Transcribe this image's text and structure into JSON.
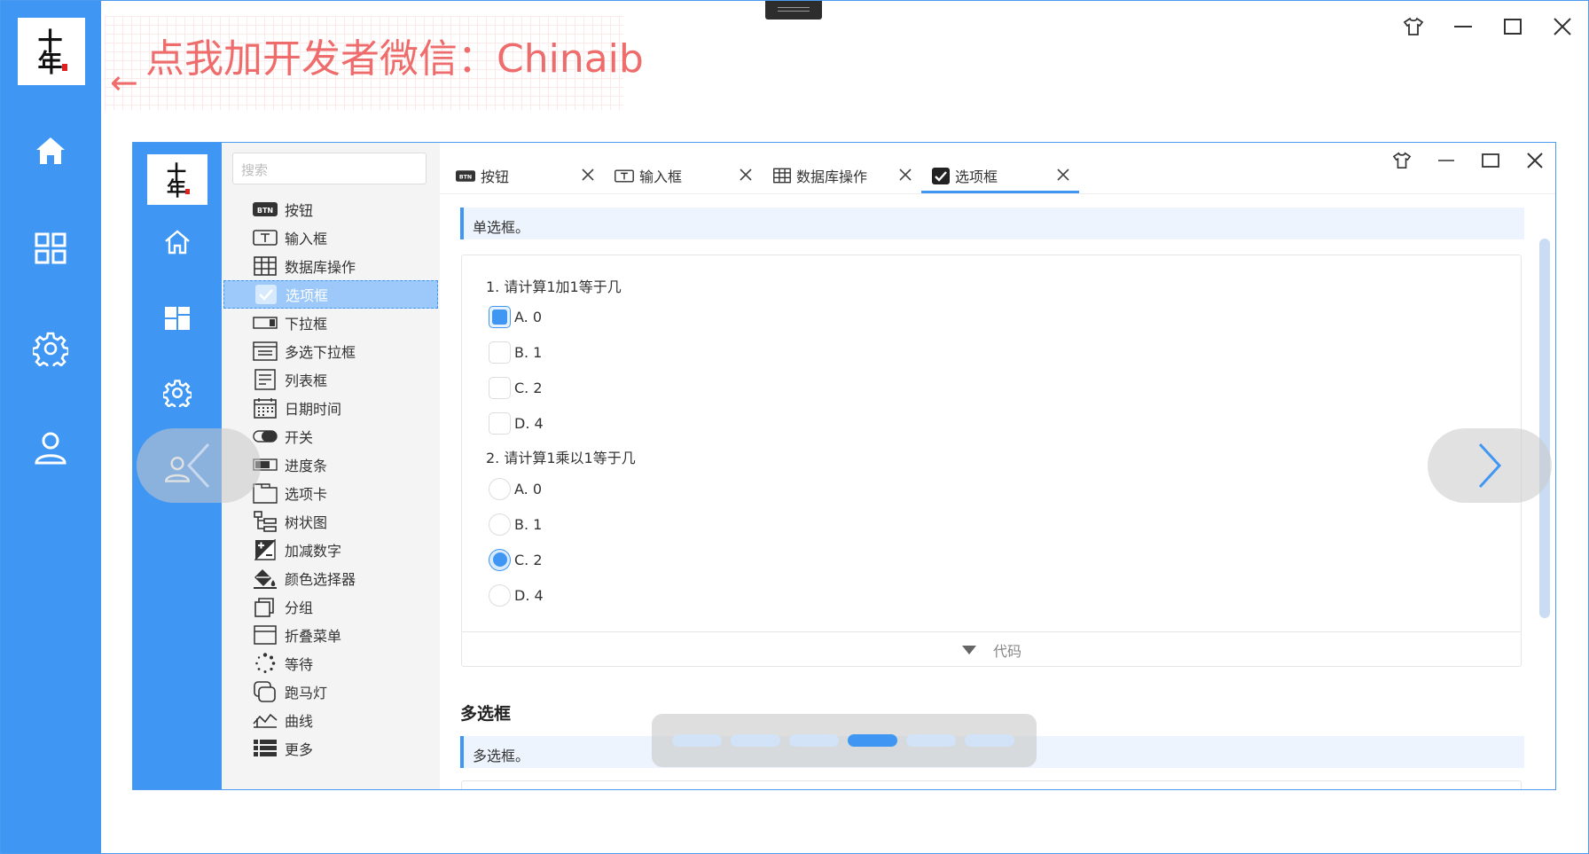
{
  "colors": {
    "accent": "#3f97f3",
    "promo": "#ef6c6c",
    "sidebar": "#3f97f3",
    "menu_active": "#9cc9fa"
  },
  "window": {
    "logo_text": "十年",
    "controls": [
      "shirt-icon",
      "minimize-icon",
      "maximize-icon",
      "close-icon"
    ]
  },
  "outer_nav": [
    {
      "icon": "home-icon"
    },
    {
      "icon": "grid-icon"
    },
    {
      "icon": "settings-icon"
    },
    {
      "icon": "user-icon"
    }
  ],
  "promo": {
    "text": "点我加开发者微信：Chinaib",
    "arrow": "←"
  },
  "inner": {
    "logo_text": "十年",
    "nav": [
      {
        "icon": "home-icon"
      },
      {
        "icon": "tiles-icon"
      },
      {
        "icon": "settings-icon"
      },
      {
        "icon": "user-icon"
      }
    ],
    "search_placeholder": "搜索",
    "menu": [
      {
        "label": "按钮",
        "icon": "btn-icon"
      },
      {
        "label": "输入框",
        "icon": "textbox-icon"
      },
      {
        "label": "数据库操作",
        "icon": "table-icon"
      },
      {
        "label": "选项框",
        "icon": "checkbox-icon",
        "active": true
      },
      {
        "label": "下拉框",
        "icon": "dropdown-icon"
      },
      {
        "label": "多选下拉框",
        "icon": "multiselect-icon"
      },
      {
        "label": "列表框",
        "icon": "listbox-icon"
      },
      {
        "label": "日期时间",
        "icon": "calendar-icon"
      },
      {
        "label": "开关",
        "icon": "toggle-icon"
      },
      {
        "label": "进度条",
        "icon": "progress-icon"
      },
      {
        "label": "选项卡",
        "icon": "tabs-icon"
      },
      {
        "label": "树状图",
        "icon": "tree-icon"
      },
      {
        "label": "加减数字",
        "icon": "plusminus-icon"
      },
      {
        "label": "颜色选择器",
        "icon": "paint-bucket-icon"
      },
      {
        "label": "分组",
        "icon": "group-icon"
      },
      {
        "label": "折叠菜单",
        "icon": "accordion-icon"
      },
      {
        "label": "等待",
        "icon": "spinner-icon"
      },
      {
        "label": "跑马灯",
        "icon": "marquee-icon"
      },
      {
        "label": "曲线",
        "icon": "curve-icon"
      },
      {
        "label": "更多",
        "icon": "more-list-icon"
      }
    ],
    "tabs": [
      {
        "label": "按钮",
        "icon": "btn-icon"
      },
      {
        "label": "输入框",
        "icon": "textbox-icon"
      },
      {
        "label": "数据库操作",
        "icon": "table-icon"
      },
      {
        "label": "选项框",
        "icon": "checkbox-icon",
        "active": true
      }
    ],
    "section1": {
      "desc": "单选框。"
    },
    "q1": {
      "title": "1. 请计算1加1等于几",
      "options": [
        "A. 0",
        "B. 1",
        "C. 2",
        "D. 4"
      ],
      "checked": 0
    },
    "q2": {
      "title": "2. 请计算1乘以1等于几",
      "options": [
        "A. 0",
        "B. 1",
        "C. 2",
        "D. 4"
      ],
      "checked": 2
    },
    "code_label": "代码",
    "section2": {
      "title": "多选框",
      "desc": "多选框。"
    },
    "carousel": {
      "dot_count": 6,
      "active_dot": 3
    }
  }
}
